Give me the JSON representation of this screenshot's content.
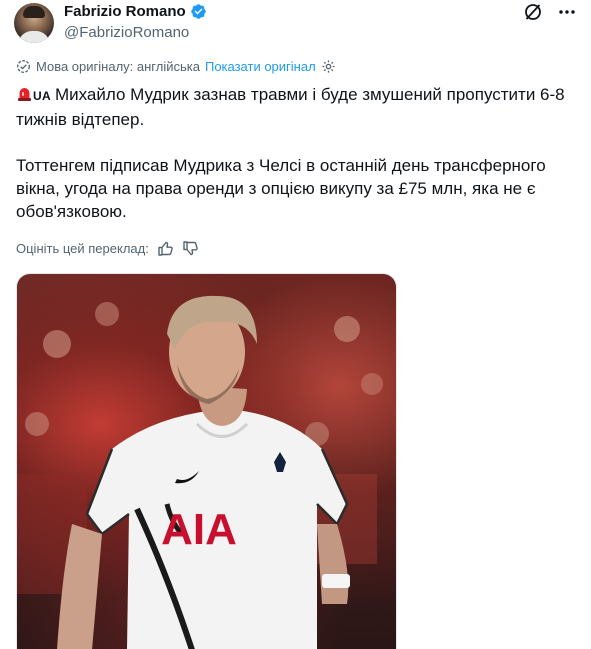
{
  "author": {
    "display_name": "Fabrizio Romano",
    "handle": "@FabrizioRomano",
    "verified": true,
    "avatar": "avatar-photo"
  },
  "header_icons": [
    "grok-icon",
    "more-options-icon"
  ],
  "translation": {
    "original_language_label": "Мова оригіналу: англійська",
    "show_original_label": "Показати оригінал",
    "globe_icon": "translate-icon",
    "settings_icon": "gear-icon"
  },
  "tweet": {
    "emoji": "siren-icon",
    "flag_code": "UA",
    "line1": "Михайло Мудрик зазнав травми і буде змушений пропустити 6-8 тижнів відтепер.",
    "line2": "Тоттенгем підписав Мудрика з Челсі в останній день трансферного вікна, угода на права оренди з опцією викупу за £75 млн, яка не є обов'язковою."
  },
  "rating": {
    "prompt": "Оцініть цей переклад:",
    "up_icon": "thumbs-up-icon",
    "down_icon": "thumbs-down-icon"
  },
  "media": {
    "shirt_sponsor": "AIA",
    "colors": {
      "sponsor": "#c8102e",
      "shirt": "#f3f3f3",
      "crowd": "#7a2a25"
    }
  },
  "colors": {
    "accent": "#1d9bf0",
    "text": "#0f1419",
    "muted": "#536471"
  }
}
